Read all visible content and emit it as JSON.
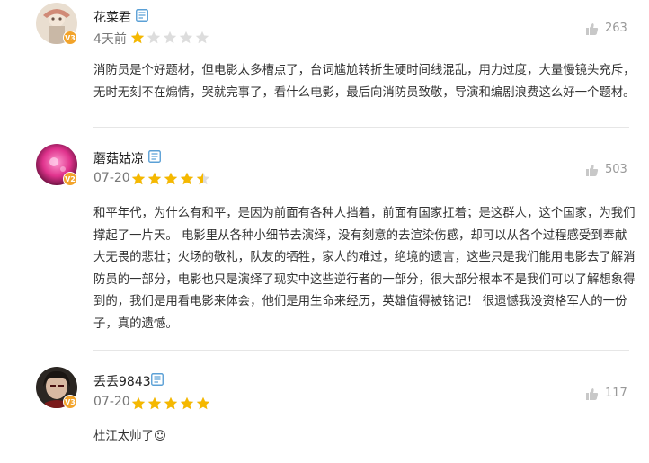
{
  "reviews": [
    {
      "username": "花菜君",
      "level": "V3",
      "time": "4天前",
      "rating": 1,
      "likes": "263",
      "content_lines": [
        "消防员是个好题材，但电影太多槽点了，台词尴尬转折生硬时间线混乱，用力过度，大量慢镜头充斥，",
        "无时无刻不在煽情，哭就完事了，看什么电影，最后向消防员致敬，导演和编剧浪费这么好一个题材。"
      ]
    },
    {
      "username": "蘑菇姑凉",
      "level": "V2",
      "time": "07-20",
      "rating": 4.5,
      "likes": "503",
      "content_lines": [
        "和平年代，为什么有和平，是因为前面有各种人挡着，前面有国家扛着；是这群人，这个国家，为我们",
        "撑起了一片天。 电影里从各种小细节去演绎，没有刻意的去渲染伤感，却可以从各个过程感受到奉献",
        "大无畏的悲壮；火场的敬礼，队友的牺牲，家人的难过，绝境的遗言，这些只是我们能用电影去了解消",
        "防员的一部分，电影也只是演绎了现实中这些逆行者的一部分，很大部分根本不是我们可以了解想象得",
        "到的，我们是用看电影来体会，他们是用生命来经历，英雄值得被铭记！ 很遗憾我没资格军人的一份",
        "子，真的遗憾。"
      ]
    },
    {
      "username": "丢丢9843",
      "level": "V3",
      "time": "07-20",
      "rating": 5,
      "likes": "117",
      "content_lines": [
        "杜江太帅了☺"
      ]
    }
  ],
  "icons": {
    "user_type": "ticket-icon",
    "like": "thumbs-up-icon",
    "star": "star-icon"
  },
  "colors": {
    "star_on": "#f5b800",
    "star_off": "#dddddd",
    "badge": "#f2a32a",
    "tag_icon": "#5ba0d6",
    "like_icon": "#c8c8c8"
  }
}
